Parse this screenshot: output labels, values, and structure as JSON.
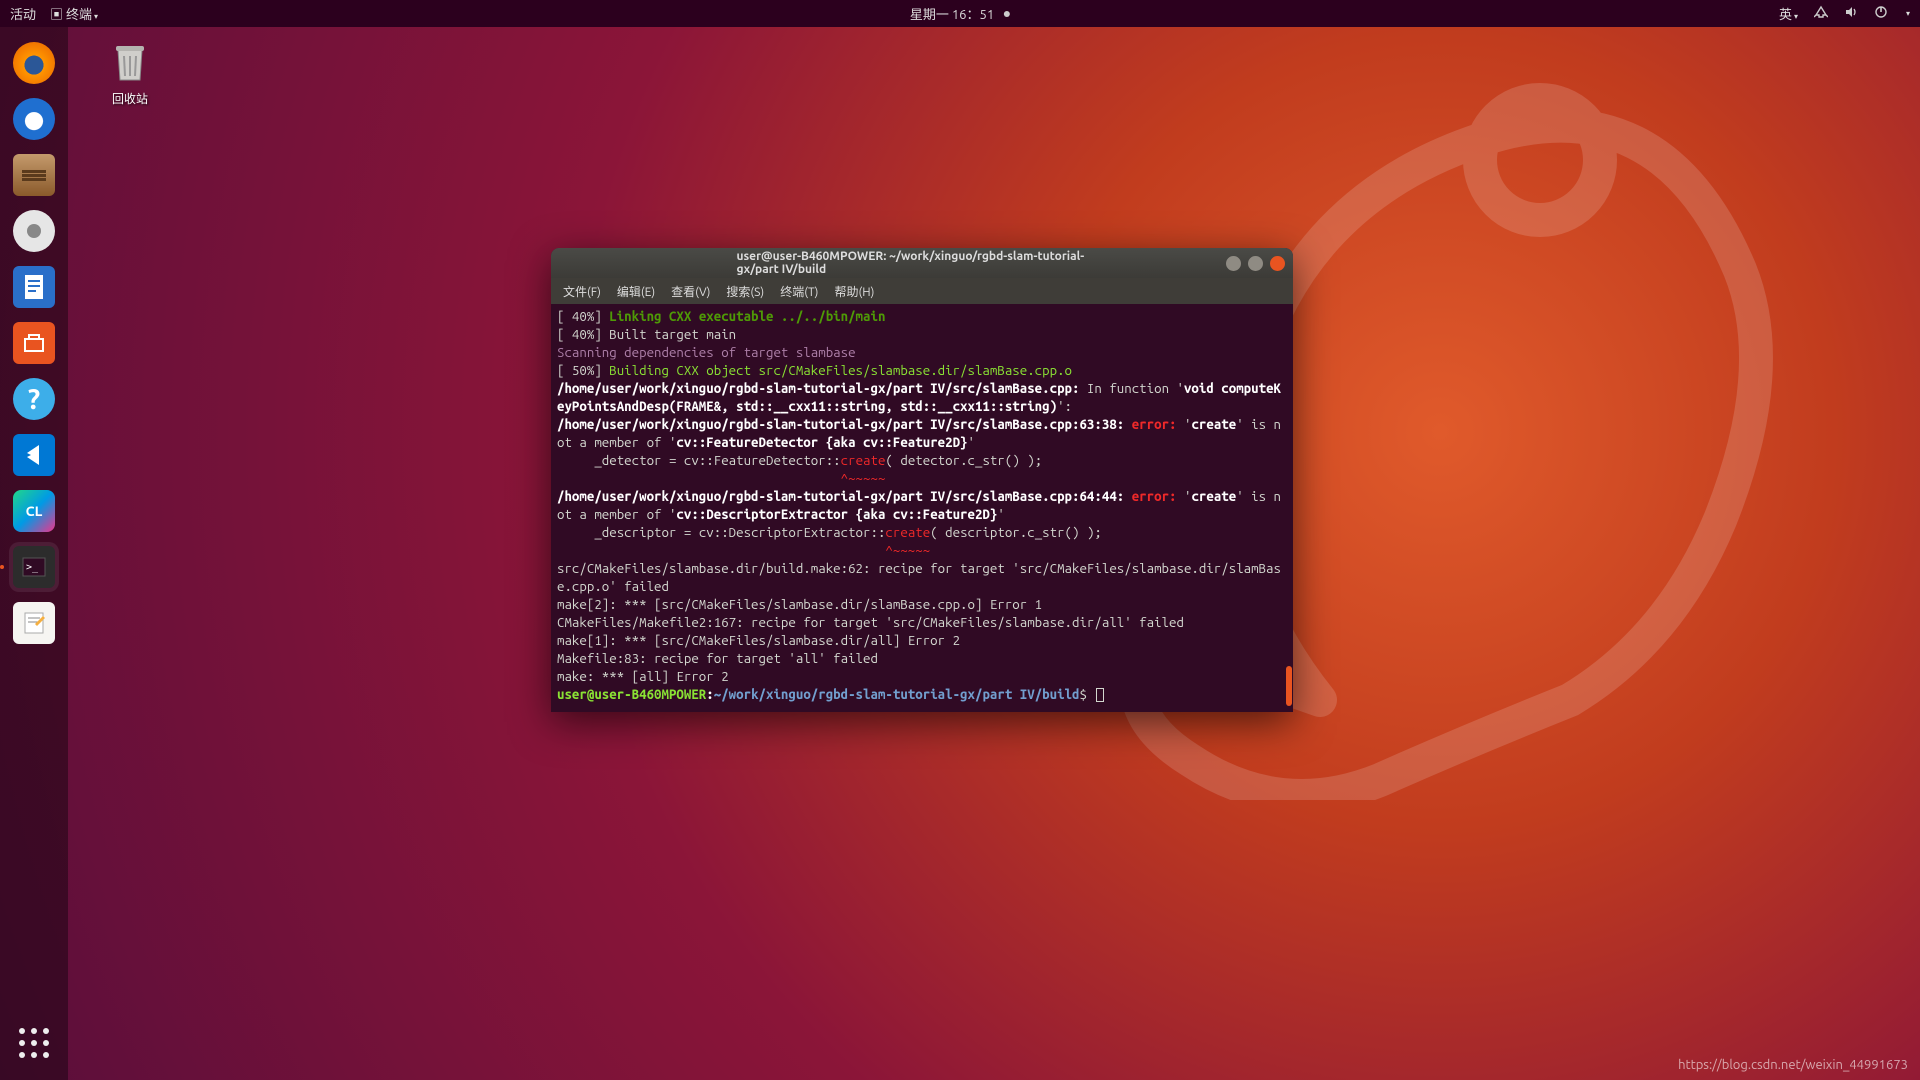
{
  "topbar": {
    "activities": "活动",
    "app_indicator": "终端",
    "clock": "星期一 16：51",
    "ime": "英"
  },
  "desktop": {
    "trash_label": "回收站"
  },
  "dock": {
    "items": [
      {
        "name": "firefox"
      },
      {
        "name": "thunderbird"
      },
      {
        "name": "files"
      },
      {
        "name": "disks"
      },
      {
        "name": "writer"
      },
      {
        "name": "software"
      },
      {
        "name": "help"
      },
      {
        "name": "vscode"
      },
      {
        "name": "clion"
      },
      {
        "name": "terminal"
      },
      {
        "name": "text-editor"
      }
    ]
  },
  "window": {
    "title": "user@user-B460MPOWER: ~/work/xinguo/rgbd-slam-tutorial-gx/part IV/build",
    "menu": {
      "file": "文件(F)",
      "edit": "编辑(E)",
      "view": "查看(V)",
      "search": "搜索(S)",
      "terminal": "终端(T)",
      "help": "帮助(H)"
    }
  },
  "terminal": {
    "l1a": "[ 40%] ",
    "l1b": "Linking CXX executable ../../bin/main",
    "l2": "[ 40%] Built target main",
    "l3": "Scanning dependencies of target slambase",
    "l4a": "[ 50%] ",
    "l4b": "Building CXX object src/CMakeFiles/slambase.dir/slamBase.cpp.o",
    "l5a": "/home/user/work/xinguo/rgbd-slam-tutorial-gx/part IV/src/slamBase.cpp:",
    "l5b": " In function '",
    "l5c": "void computeKeyPointsAndDesp(FRAME&, std::__cxx11::string, std::__cxx11::string)",
    "l5d": "':",
    "l6a": "/home/user/work/xinguo/rgbd-slam-tutorial-gx/part IV/src/slamBase.cpp:63:38:",
    "l6b": " error:",
    "l6c": " '",
    "l6d": "create",
    "l6e": "' is not a member of '",
    "l6f": "cv::FeatureDetector {aka cv::Feature2D}",
    "l6g": "'",
    "l7": "     _detector = cv::FeatureDetector::",
    "l7b": "create",
    "l7c": "( detector.c_str() );",
    "l8": "                                      ",
    "l8b": "^~~~~~",
    "l9a": "/home/user/work/xinguo/rgbd-slam-tutorial-gx/part IV/src/slamBase.cpp:64:44:",
    "l9b": " error:",
    "l9c": " '",
    "l9d": "create",
    "l9e": "' is not a member of '",
    "l9f": "cv::DescriptorExtractor {aka cv::Feature2D}",
    "l9g": "'",
    "l10": "     _descriptor = cv::DescriptorExtractor::",
    "l10b": "create",
    "l10c": "( descriptor.c_str() );",
    "l11": "                                            ",
    "l11b": "^~~~~~",
    "l12": "src/CMakeFiles/slambase.dir/build.make:62: recipe for target 'src/CMakeFiles/slambase.dir/slamBase.cpp.o' failed",
    "l13": "make[2]: *** [src/CMakeFiles/slambase.dir/slamBase.cpp.o] Error 1",
    "l14": "CMakeFiles/Makefile2:167: recipe for target 'src/CMakeFiles/slambase.dir/all' failed",
    "l15": "make[1]: *** [src/CMakeFiles/slambase.dir/all] Error 2",
    "l16": "Makefile:83: recipe for target 'all' failed",
    "l17": "make: *** [all] Error 2",
    "prompt_user": "user@user-B460MPOWER",
    "prompt_sep": ":",
    "prompt_path": "~/work/xinguo/rgbd-slam-tutorial-gx/part IV/build",
    "prompt_dollar": "$ "
  },
  "watermark": "https://blog.csdn.net/weixin_44991673"
}
